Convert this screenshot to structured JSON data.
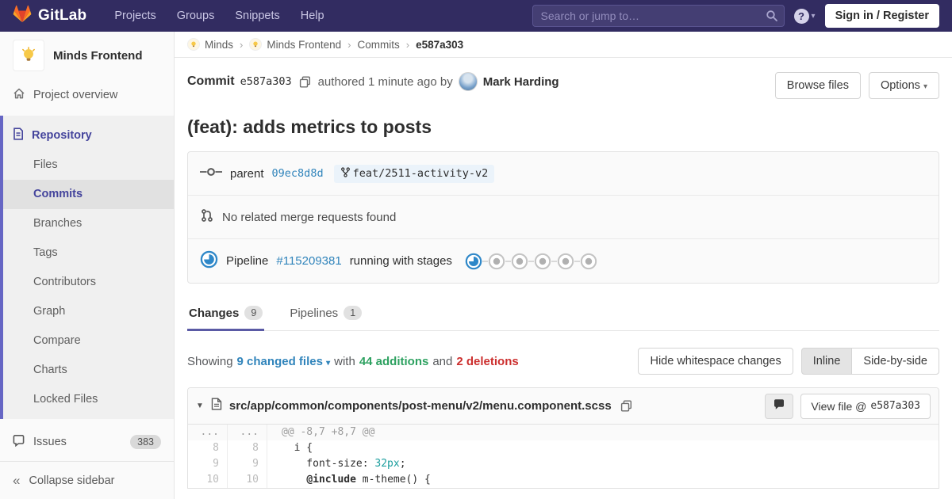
{
  "colors": {
    "navbar_bg": "#322c61",
    "accent_purple": "#6666c4",
    "active_text": "#44449c",
    "link_blue": "#3084bb",
    "additions_green": "#2da160",
    "deletions_red": "#cc2f2e",
    "scss_value_teal": "#1c9e9e",
    "brand_orange": "#fc6d26"
  },
  "navbar": {
    "brand": "GitLab",
    "links": [
      "Projects",
      "Groups",
      "Snippets",
      "Help"
    ],
    "search_placeholder": "Search or jump to…",
    "sign_in_label": "Sign in / Register"
  },
  "sidebar": {
    "project_name": "Minds Frontend",
    "overview_label": "Project overview",
    "repository_label": "Repository",
    "repo_items": [
      {
        "label": "Files",
        "active": false
      },
      {
        "label": "Commits",
        "active": true
      },
      {
        "label": "Branches",
        "active": false
      },
      {
        "label": "Tags",
        "active": false
      },
      {
        "label": "Contributors",
        "active": false
      },
      {
        "label": "Graph",
        "active": false
      },
      {
        "label": "Compare",
        "active": false
      },
      {
        "label": "Charts",
        "active": false
      },
      {
        "label": "Locked Files",
        "active": false
      }
    ],
    "issues_label": "Issues",
    "issues_count": "383",
    "collapse_label": "Collapse sidebar"
  },
  "breadcrumb": {
    "items": [
      {
        "label": "Minds",
        "avatar": true
      },
      {
        "label": "Minds Frontend",
        "avatar": true
      },
      {
        "label": "Commits",
        "avatar": false
      }
    ],
    "current": "e587a303"
  },
  "commit": {
    "label": "Commit",
    "sha": "e587a303",
    "authored_text": "authored 1 minute ago by",
    "author_name": "Mark Harding",
    "browse_files_label": "Browse files",
    "options_label": "Options",
    "title": "(feat): adds metrics to posts",
    "parent_label": "parent",
    "parent_sha": "09ec8d8d",
    "branch_name": "feat/2511-activity-v2",
    "merge_request_text": "No related merge requests found",
    "pipeline_label": "Pipeline",
    "pipeline_id": "#115209381",
    "pipeline_status_text": "running with stages",
    "pipeline_stages": [
      "running",
      "created",
      "created",
      "created",
      "created",
      "created"
    ]
  },
  "tabs": [
    {
      "label": "Changes",
      "count": "9",
      "active": true
    },
    {
      "label": "Pipelines",
      "count": "1",
      "active": false
    }
  ],
  "diff_summary": {
    "showing_label": "Showing",
    "changed_files": "9 changed files",
    "with_label": "with",
    "additions": "44 additions",
    "and_label": "and",
    "deletions": "2 deletions",
    "hide_whitespace_label": "Hide whitespace changes",
    "inline_label": "Inline",
    "side_by_side_label": "Side-by-side"
  },
  "diff_file": {
    "path": "src/app/common/components/post-menu/v2/menu.component.scss",
    "view_file_label": "View file @",
    "view_file_sha": "e587a303",
    "lines": [
      {
        "old": "...",
        "new": "...",
        "type": "hunk",
        "segments": [
          {
            "text": "@@ -8,7 +8,7 @@"
          }
        ]
      },
      {
        "old": "8",
        "new": "8",
        "type": "context",
        "segments": [
          {
            "text": "  i {"
          }
        ]
      },
      {
        "old": "9",
        "new": "9",
        "type": "context",
        "segments": [
          {
            "text": "    font-size: "
          },
          {
            "text": "32px",
            "cls": "teal"
          },
          {
            "text": ";"
          }
        ]
      },
      {
        "old": "10",
        "new": "10",
        "type": "context",
        "segments": [
          {
            "text": "    "
          },
          {
            "text": "@include",
            "cls": "bold"
          },
          {
            "text": " m-theme() {"
          }
        ]
      }
    ]
  }
}
